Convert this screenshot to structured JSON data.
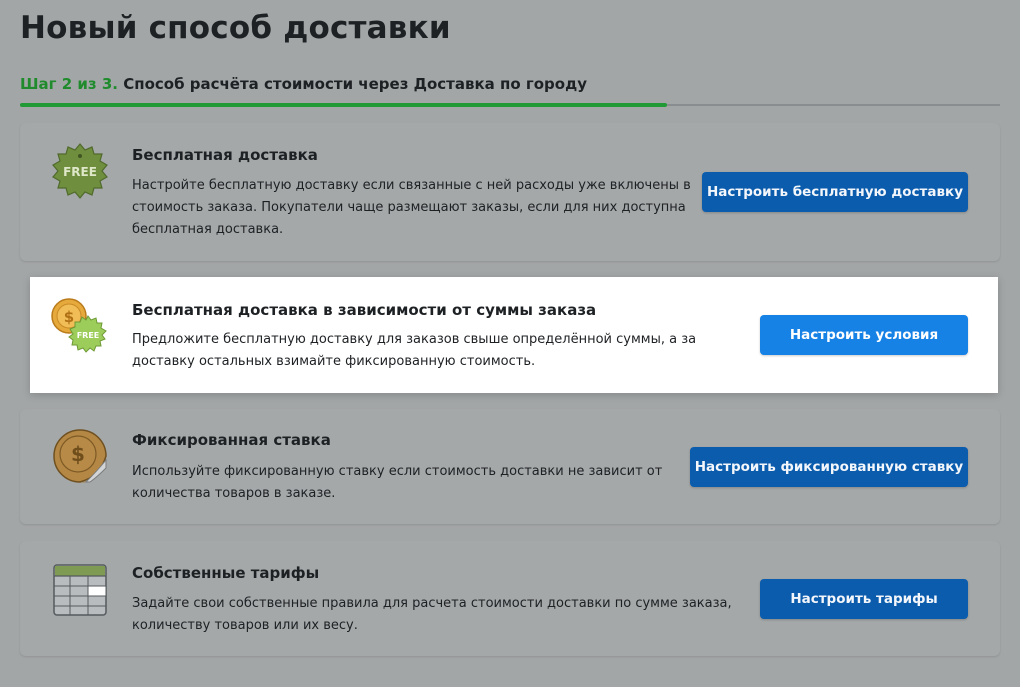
{
  "page": {
    "title": "Новый способ доставки",
    "step_num": "Шаг 2 из 3.",
    "step_text": " Способ расчёта стоимости через Доставка по городу",
    "progress": 0.66
  },
  "colors": {
    "step_green": "#1f8b2c",
    "button_blue": "#0b5cad",
    "button_blue_active": "#1682e6"
  },
  "cards": [
    {
      "icon": "free-badge-icon",
      "icon_text": "FREE",
      "title": "Бесплатная доставка",
      "desc": "Настройте бесплатную доставку если связанные с ней расходы уже включены в стоимость заказа. Покупатели чаще размещают заказы, если для них доступна бесплатная доставка.",
      "button": "Настроить бесплатную доставку"
    },
    {
      "icon": "coin-free-badge-icon",
      "icon_text": "FREE",
      "title": "Бесплатная доставка в зависимости от суммы заказа",
      "desc": "Предложите бесплатную доставку для заказов свыше определённой суммы, а за доставку остальных взимайте фиксированную стоимость.",
      "button": "Настроить условия"
    },
    {
      "icon": "coin-sticker-icon",
      "title": "Фиксированная ставка",
      "desc": "Используйте фиксированную ставку если стоимость доставки не зависит от количества товаров в заказе.",
      "button": "Настроить фиксированную ставку"
    },
    {
      "icon": "table-icon",
      "title": "Собственные тарифы",
      "desc": "Задайте свои собственные правила для расчета стоимости доставки по сумме заказа, количеству товаров или их весу.",
      "button": "Настроить тарифы"
    }
  ]
}
